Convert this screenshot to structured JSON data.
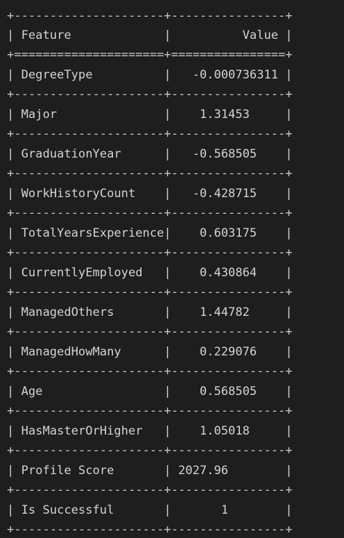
{
  "table": {
    "border_line": "+---------------------+----------------+",
    "header_separator": "+=====================+================+",
    "header": {
      "feature": "Feature",
      "value": "Value"
    },
    "rows": [
      {
        "feature": "DegreeType",
        "value": "-0.000736311",
        "align": "right"
      },
      {
        "feature": "Major",
        "value": "1.31453",
        "align": "center"
      },
      {
        "feature": "GraduationYear",
        "value": "-0.568505",
        "align": "center"
      },
      {
        "feature": "WorkHistoryCount",
        "value": "-0.428715",
        "align": "center"
      },
      {
        "feature": "TotalYearsExperience",
        "value": "0.603175",
        "align": "center"
      },
      {
        "feature": "CurrentlyEmployed",
        "value": "0.430864",
        "align": "center"
      },
      {
        "feature": "ManagedOthers",
        "value": "1.44782",
        "align": "center"
      },
      {
        "feature": "ManagedHowMany",
        "value": "0.229076",
        "align": "center"
      },
      {
        "feature": "Age",
        "value": "0.568505",
        "align": "center"
      },
      {
        "feature": "HasMasterOrHigher",
        "value": "1.05018",
        "align": "center"
      },
      {
        "feature": "Profile Score",
        "value": "2027.96",
        "align": "left"
      },
      {
        "feature": "Is Successful",
        "value": "1",
        "align": "center"
      }
    ]
  },
  "colors": {
    "background": "#1e1e1e",
    "text": "#cccccc"
  }
}
